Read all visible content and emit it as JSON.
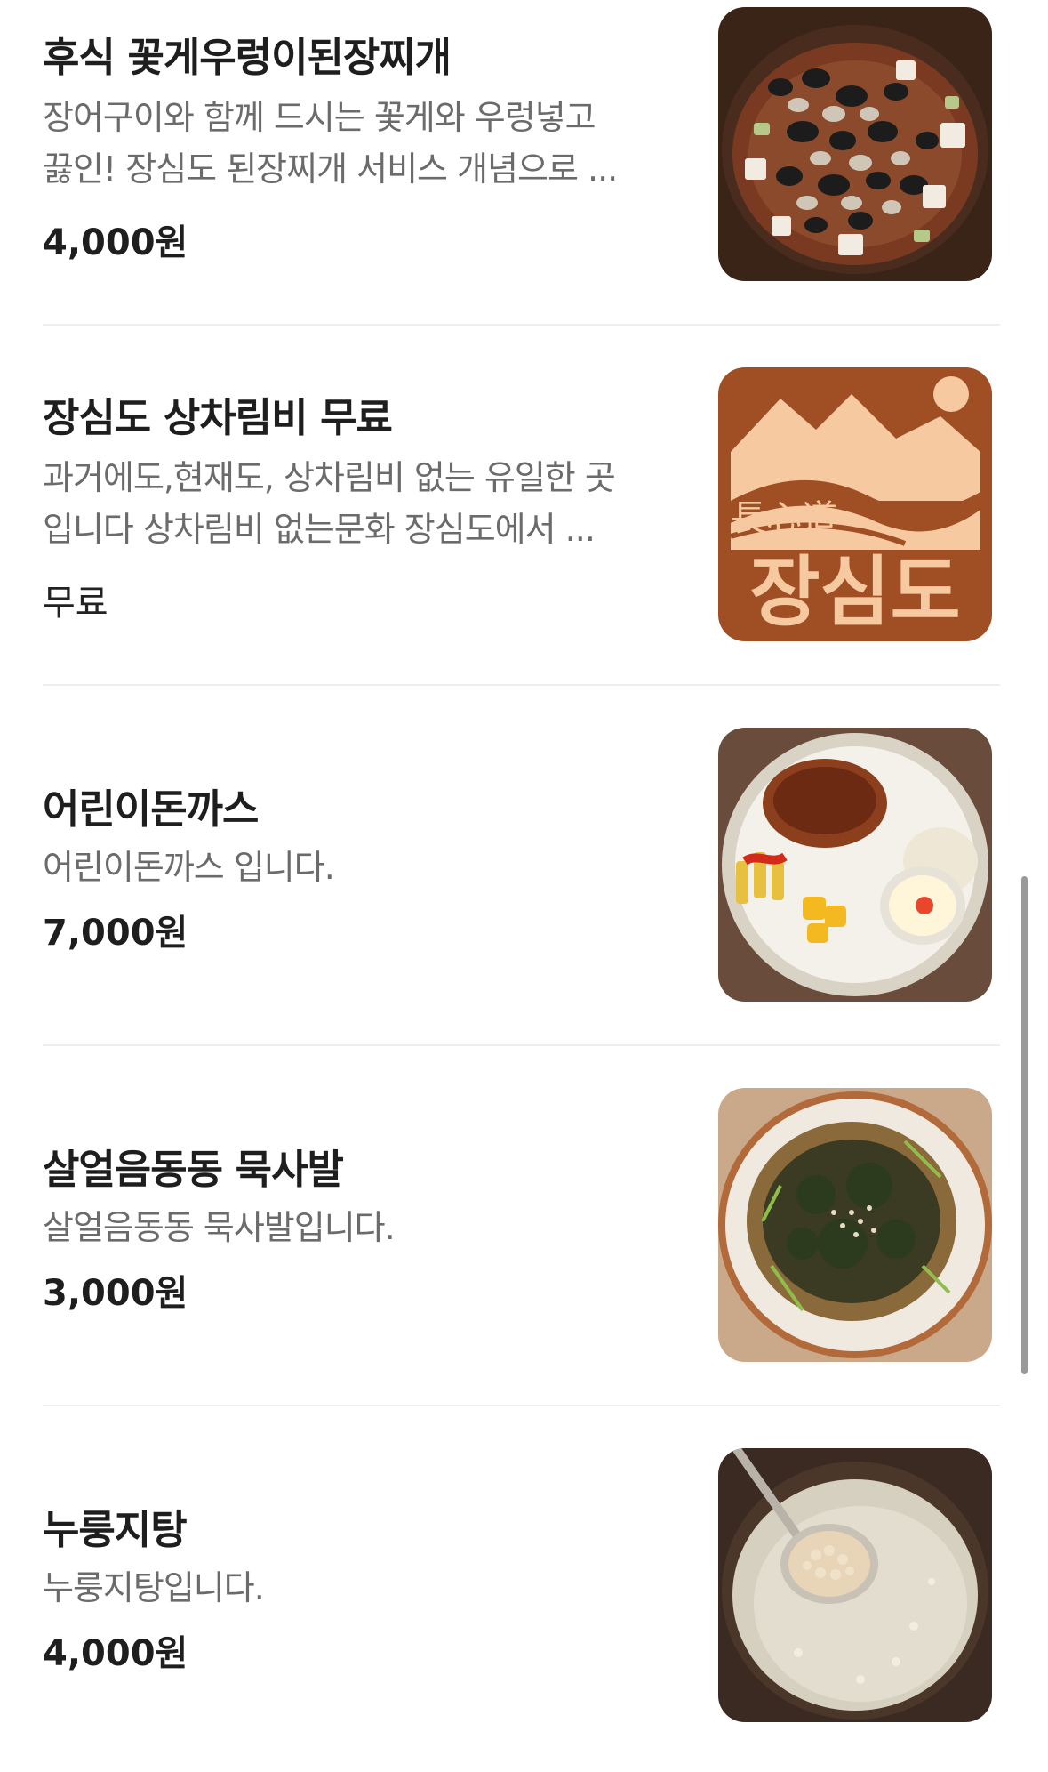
{
  "menu": {
    "items": [
      {
        "name": "후식 꽃게우렁이된장찌개",
        "desc_line1": "장어구이와 함께 드시는 꽃게와 우렁넣고",
        "desc_line2": "끓인! 장심도 된장찌개 서비스 개념으로 ...",
        "price": "4,000원",
        "image": "doenjang-stew-photo"
      },
      {
        "name": "장심도 상차림비 무료",
        "desc_line1": "과거에도,현재도, 상차림비 없는 유일한 곳",
        "desc_line2": "입니다 상차림비 없는문화 장심도에서 ...",
        "price": "무료",
        "image": "jangsimdo-logo",
        "logo_hanja": "長心道",
        "logo_text": "장심도"
      },
      {
        "name": "어린이돈까스",
        "desc_line1": "어린이돈까스 입니다.",
        "price": "7,000원",
        "image": "kids-pork-cutlet-photo"
      },
      {
        "name": "살얼음동동 묵사발",
        "desc_line1": "살얼음동동 묵사발입니다.",
        "price": "3,000원",
        "image": "muksabal-photo"
      },
      {
        "name": "누룽지탕",
        "desc_line1": "누룽지탕입니다.",
        "price": "4,000원",
        "image": "nurungji-soup-photo"
      }
    ]
  },
  "colors": {
    "title": "#1e1e1e",
    "description": "#6b6b6b",
    "divider": "#eeeeee",
    "logo_background": "#a04f24",
    "logo_foreground": "#f6c9a0"
  }
}
